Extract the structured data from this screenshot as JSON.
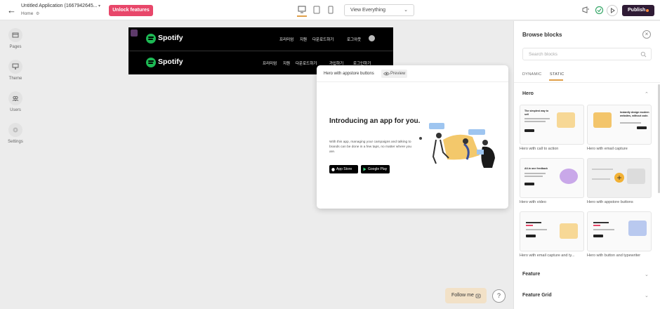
{
  "topbar": {
    "app_title": "Untitled Application (1667942645...",
    "breadcrumb": "Home",
    "unlock_label": "Unlock features",
    "view_select": "View Everything",
    "publish_label": "Publish"
  },
  "sidebar": {
    "items": [
      {
        "label": "Pages",
        "icon": "pages-icon"
      },
      {
        "label": "Theme",
        "icon": "theme-icon"
      },
      {
        "label": "Users",
        "icon": "users-icon"
      },
      {
        "label": "Settings",
        "icon": "settings-icon"
      }
    ]
  },
  "site_preview": {
    "brand": "Spotify",
    "nav_row_1": [
      "프리미엄",
      "지원",
      "다운로드하기",
      "로그아웃"
    ],
    "nav_row_2": [
      "프리미엄",
      "지원",
      "다운로드하기",
      "가입하기",
      "로그인하기"
    ]
  },
  "hero_card": {
    "title": "Hero with appstore buttons",
    "preview_label": "Preview",
    "heading": "Introducing an app for you.",
    "body": "With this app, managing your campaigns and talking to brands can be done in a few taps, no matter where you are.",
    "app_store": "App Store",
    "google_play": "Google Play"
  },
  "browse": {
    "title": "Browse blocks",
    "search_placeholder": "Search blocks",
    "tabs": [
      "DYNAMIC",
      "STATIC"
    ],
    "active_tab": "STATIC",
    "sections": {
      "hero": "Hero",
      "feature": "Feature",
      "feature_grid": "Feature Grid"
    },
    "hero_blocks": [
      "Hero with call to action",
      "Hero with email capture",
      "Hero with video",
      "Hero with appstore buttons",
      "Hero with email capture and ty...",
      "Hero with button and typewriter"
    ],
    "thumb_headlines": {
      "cta": "The simplest way to sell",
      "email": "Instantly design modern websites, without code.",
      "video": "All-in one feedback"
    }
  },
  "floating": {
    "follow_label": "Follow me",
    "help_label": "?"
  },
  "colors": {
    "unlock": "#e8476a",
    "publish": "#2f1b35",
    "accent": "#e0a04a",
    "spotify_green": "#1db954"
  }
}
